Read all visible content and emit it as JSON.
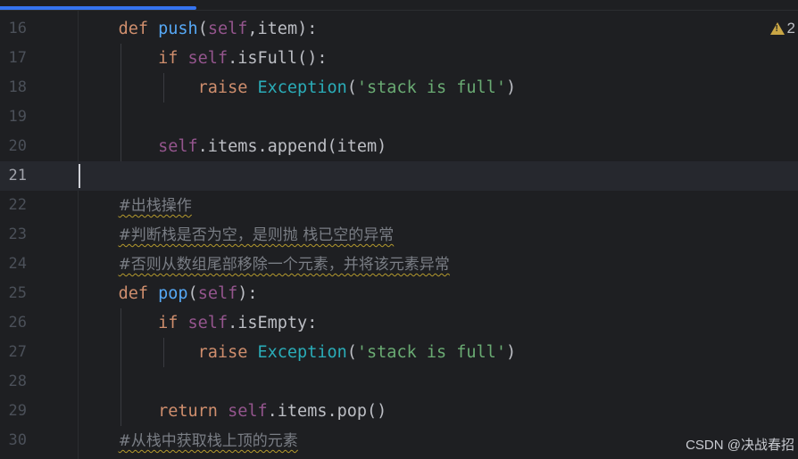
{
  "editor": {
    "warning_count": "2",
    "lines": [
      {
        "num": "16",
        "tokens": [
          {
            "t": "    "
          },
          {
            "t": "def",
            "c": "kw"
          },
          {
            "t": " "
          },
          {
            "t": "push",
            "c": "fn"
          },
          {
            "t": "("
          },
          {
            "t": "self",
            "c": "slf"
          },
          {
            "t": ",item):"
          }
        ]
      },
      {
        "num": "17",
        "tokens": [
          {
            "t": "        "
          },
          {
            "t": "if",
            "c": "kw"
          },
          {
            "t": " "
          },
          {
            "t": "self",
            "c": "slf"
          },
          {
            "t": ".isFull():"
          }
        ]
      },
      {
        "num": "18",
        "tokens": [
          {
            "t": "            "
          },
          {
            "t": "raise",
            "c": "kw"
          },
          {
            "t": " "
          },
          {
            "t": "Exception",
            "c": "cls"
          },
          {
            "t": "("
          },
          {
            "t": "'stack is full'",
            "c": "str"
          },
          {
            "t": ")"
          }
        ]
      },
      {
        "num": "19",
        "tokens": []
      },
      {
        "num": "20",
        "tokens": [
          {
            "t": "        "
          },
          {
            "t": "self",
            "c": "slf"
          },
          {
            "t": ".items.append(item)"
          }
        ]
      },
      {
        "num": "21",
        "tokens": [],
        "current": true
      },
      {
        "num": "22",
        "tokens": [
          {
            "t": "    "
          },
          {
            "t": "#出栈操作",
            "c": "cmt squig"
          }
        ]
      },
      {
        "num": "23",
        "tokens": [
          {
            "t": "    "
          },
          {
            "t": "#判断栈是否为空，是则抛 栈已空的异常",
            "c": "cmt squig"
          }
        ]
      },
      {
        "num": "24",
        "tokens": [
          {
            "t": "    "
          },
          {
            "t": "#否则从数组尾部移除一个元素，并将该元素异常",
            "c": "cmt squig"
          }
        ]
      },
      {
        "num": "25",
        "tokens": [
          {
            "t": "    "
          },
          {
            "t": "def",
            "c": "kw"
          },
          {
            "t": " "
          },
          {
            "t": "pop",
            "c": "fn"
          },
          {
            "t": "("
          },
          {
            "t": "self",
            "c": "slf"
          },
          {
            "t": "):"
          }
        ]
      },
      {
        "num": "26",
        "tokens": [
          {
            "t": "        "
          },
          {
            "t": "if",
            "c": "kw"
          },
          {
            "t": " "
          },
          {
            "t": "self",
            "c": "slf"
          },
          {
            "t": ".isEmpty:"
          }
        ]
      },
      {
        "num": "27",
        "tokens": [
          {
            "t": "            "
          },
          {
            "t": "raise",
            "c": "kw"
          },
          {
            "t": " "
          },
          {
            "t": "Exception",
            "c": "cls"
          },
          {
            "t": "("
          },
          {
            "t": "'stack is full'",
            "c": "str"
          },
          {
            "t": ")"
          }
        ]
      },
      {
        "num": "28",
        "tokens": []
      },
      {
        "num": "29",
        "tokens": [
          {
            "t": "        "
          },
          {
            "t": "return",
            "c": "kw"
          },
          {
            "t": " "
          },
          {
            "t": "self",
            "c": "slf"
          },
          {
            "t": ".items.pop()"
          }
        ]
      },
      {
        "num": "30",
        "tokens": [
          {
            "t": "    "
          },
          {
            "t": "#从栈中获取栈上顶的元素",
            "c": "cmt squig"
          }
        ]
      }
    ]
  },
  "watermark": "CSDN @决战春招",
  "colors": {
    "background": "#1e1f22",
    "keyword": "#cf8e6d",
    "function": "#56a8f5",
    "self": "#94558d",
    "class": "#2aacb8",
    "string": "#6aab73",
    "comment": "#7a7e85"
  }
}
